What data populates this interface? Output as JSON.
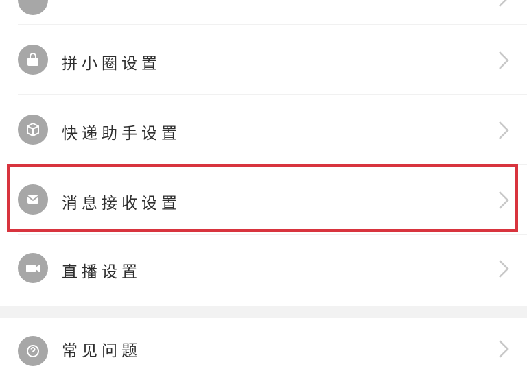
{
  "settings_list": {
    "items": [
      {
        "label": "",
        "icon": "partial-icon"
      },
      {
        "label": "拼小圈设置",
        "icon": "shopping-bag-icon"
      },
      {
        "label": "快递助手设置",
        "icon": "package-icon"
      },
      {
        "label": "消息接收设置",
        "icon": "mail-icon"
      },
      {
        "label": "直播设置",
        "icon": "video-camera-icon"
      },
      {
        "label": "常见问题",
        "icon": "help-icon"
      }
    ]
  },
  "colors": {
    "icon_bg": "#a7a7a7",
    "highlight": "#d8343e",
    "section_gap": "#f2f2f2"
  }
}
